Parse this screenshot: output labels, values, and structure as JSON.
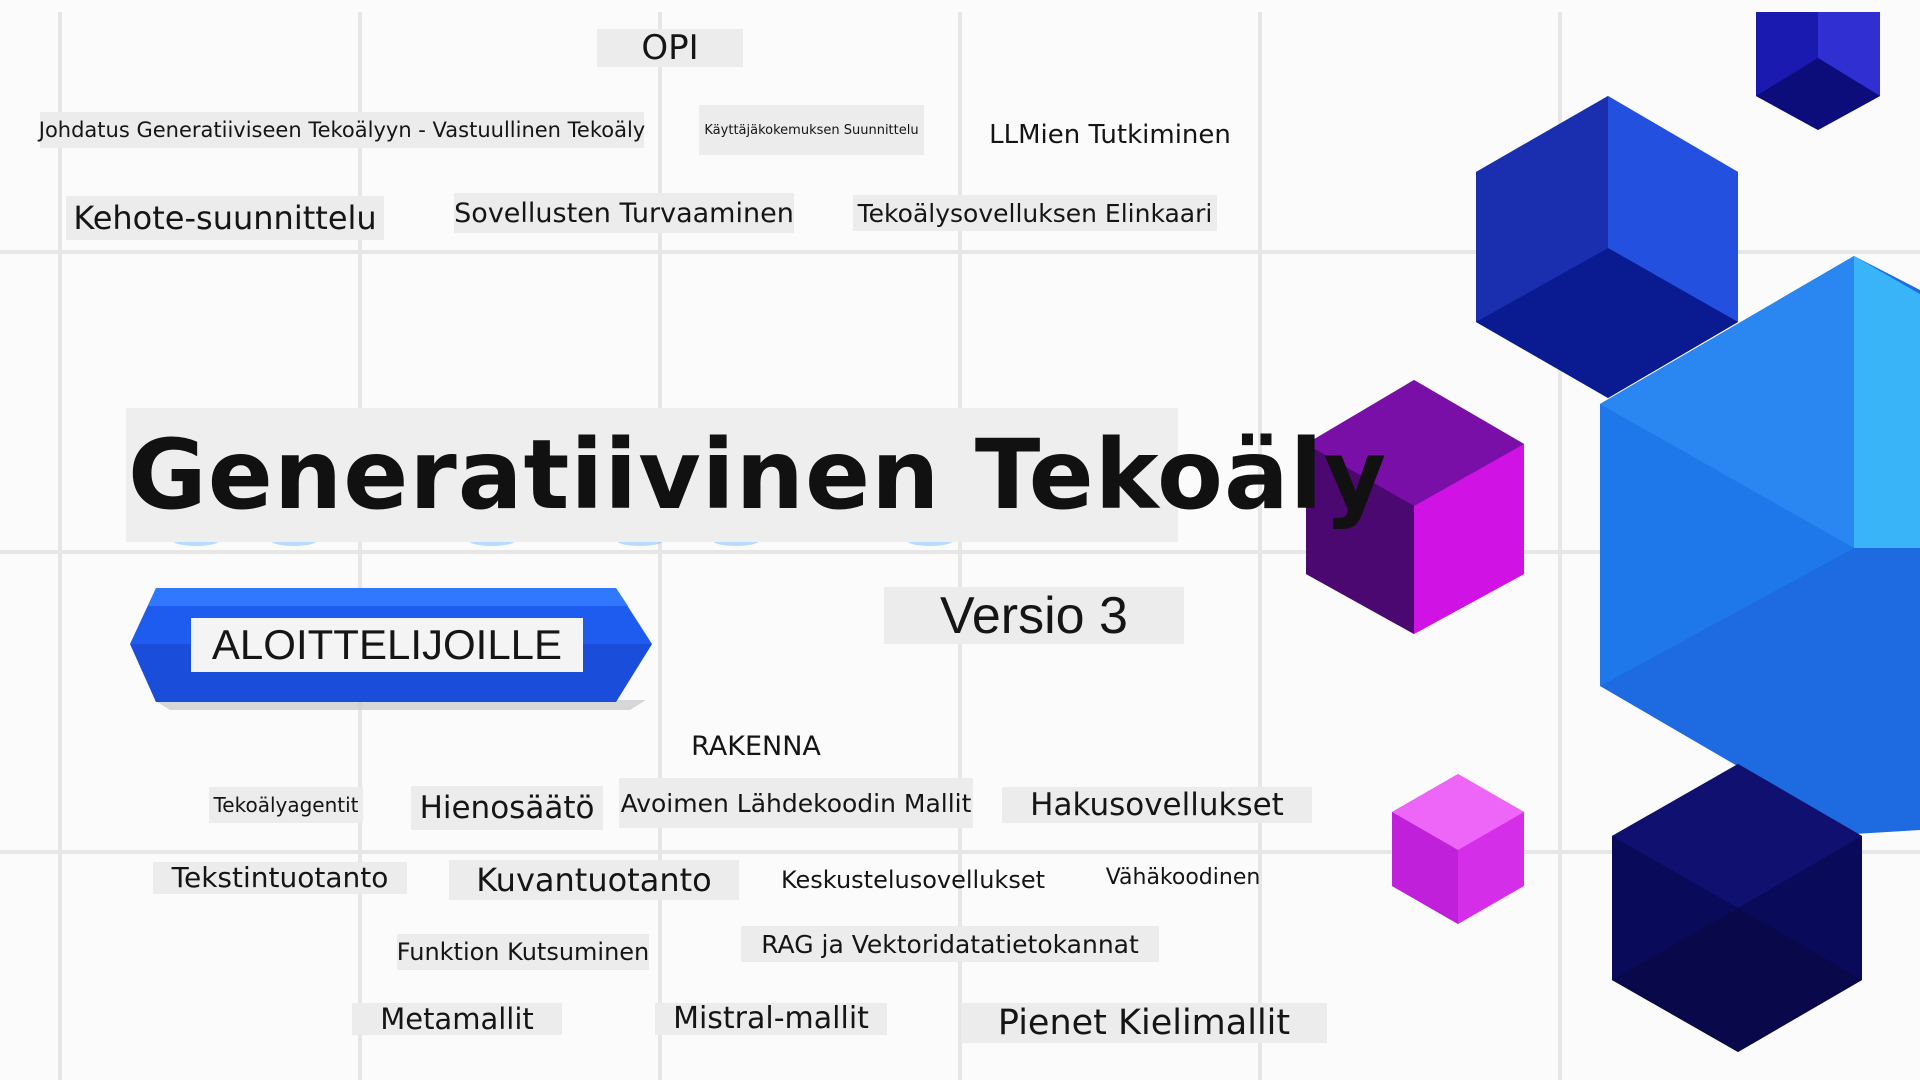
{
  "title": "Generatiivinen Tekoäly",
  "badge": "ALOITTELIJOILLE",
  "version": "Versio 3",
  "sections": {
    "learn": "OPI",
    "build": "RAKENNA"
  },
  "learn_topics": [
    "Johdatus Generatiiviseen Tekoälyyn - Vastuullinen Tekoäly",
    "Käyttäjäkokemuksen Suunnittelu",
    "LLMien Tutkiminen",
    "Kehote-suunnittelu",
    "Sovellusten Turvaaminen",
    "Tekoälysovelluksen Elinkaari"
  ],
  "build_topics": [
    "Tekoälyagentit",
    "Hienosäätö",
    "Avoimen Lähdekoodin Mallit",
    "Hakusovellukset",
    "Tekstintuotanto",
    "Kuvantuotanto",
    "Keskustelusovellukset",
    "Vähäkoodinen",
    "Funktion Kutsuminen",
    "RAG ja Vektoridatatietokannat",
    "Metamallit",
    "Mistral-mallit",
    "Pienet Kielimallit"
  ],
  "colors": {
    "badge_blue": "#1e5cf0",
    "purple": "#8a12b8",
    "magenta": "#e23cf2",
    "azure": "#2a86f0",
    "navy": "#0a0f7a"
  }
}
